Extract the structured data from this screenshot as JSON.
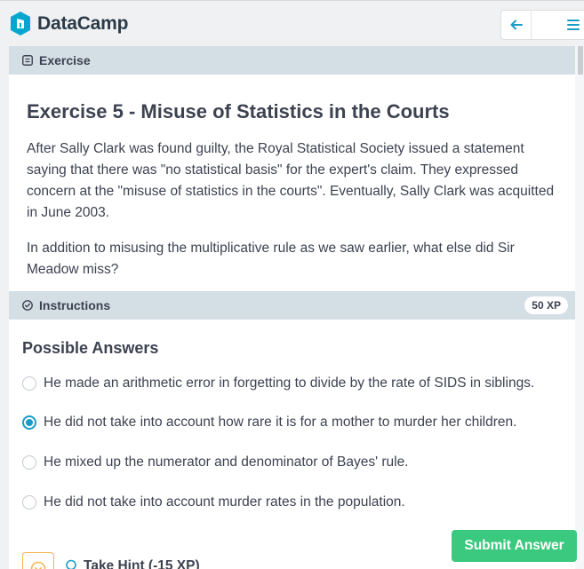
{
  "app": {
    "name": "DataCamp"
  },
  "nav": {
    "back_icon": "arrow-left-icon",
    "menu_icon": "hamburger-menu-icon"
  },
  "exercise_panel": {
    "header_label": "Exercise",
    "title": "Exercise 5 - Misuse of Statistics in the Courts",
    "paragraphs": [
      "After Sally Clark was found guilty, the Royal Statistical Society issued a statement saying that there was \"no statistical basis\" for the expert's claim. They expressed concern at the \"misuse of statistics in the courts\". Eventually, Sally Clark was acquitted in June 2003.",
      "In addition to misusing the multiplicative rule as we saw earlier, what else did Sir Meadow miss?"
    ]
  },
  "instructions_panel": {
    "header_label": "Instructions",
    "xp": "50 XP",
    "answers_title": "Possible Answers",
    "answers": [
      {
        "label": "He made an arithmetic error in forgetting to divide by the rate of SIDS in siblings.",
        "selected": false
      },
      {
        "label": "He did not take into account how rare it is for a mother to murder her children.",
        "selected": true
      },
      {
        "label": "He mixed up the numerator and denominator of Bayes' rule.",
        "selected": false
      },
      {
        "label": "He did not take into account murder rates in the population.",
        "selected": false
      }
    ],
    "submit_label": "Submit Answer",
    "hint_label": "Take Hint (-15 XP)"
  },
  "colors": {
    "accent": "#1b9cc6",
    "submit": "#3ac97e",
    "header_bg": "#d4dee5",
    "hint_border": "#f2b84b"
  }
}
